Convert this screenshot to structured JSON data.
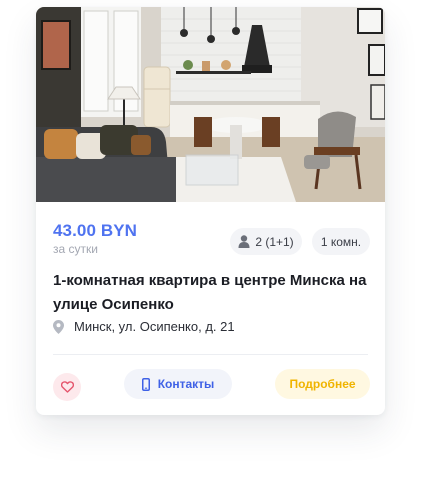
{
  "listing": {
    "price": "43.00 BYN",
    "price_period": "за сутки",
    "guests": "2 (1+1)",
    "rooms": "1 комн.",
    "title": "1-комнатная квартира в центре Минска на улице Осипенко",
    "address": "Минск, ул. Осипенко, д. 21"
  },
  "actions": {
    "favorite_icon": "heart-outline-icon",
    "contacts_label": "Контакты",
    "contacts_icon": "phone-icon",
    "details_label": "Подробнее"
  },
  "icons": {
    "guests": "person-icon",
    "address": "map-pin-icon"
  },
  "colors": {
    "price": "#4f73f0",
    "contacts_text": "#3f61e6",
    "details_text": "#f0b400",
    "favorite": "#e5566d"
  }
}
